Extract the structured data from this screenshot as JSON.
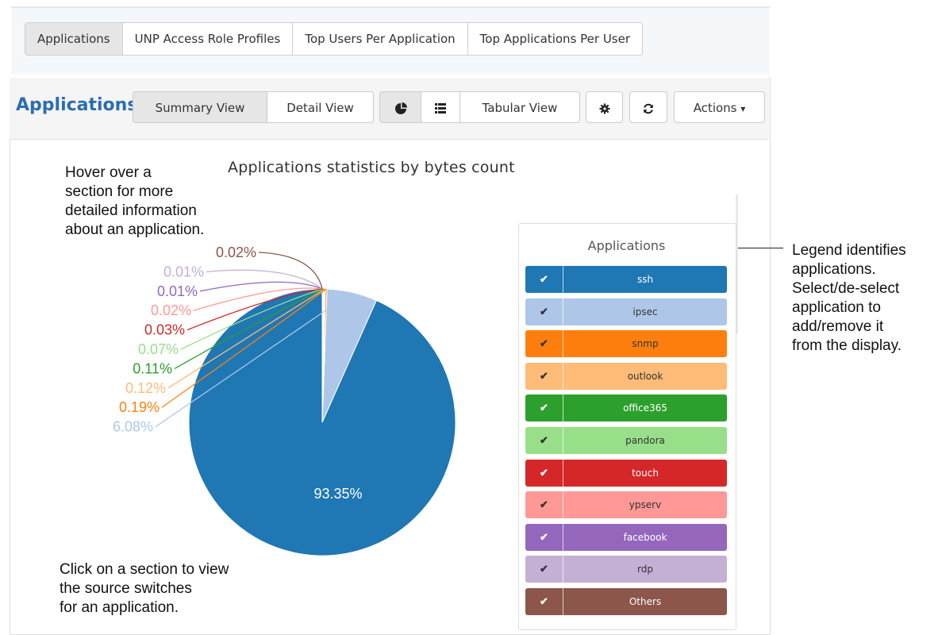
{
  "top_tabs": [
    {
      "label": "Applications",
      "active": true
    },
    {
      "label": "UNP Access Role Profiles",
      "active": false
    },
    {
      "label": "Top Users Per Application",
      "active": false
    },
    {
      "label": "Top Applications Per User",
      "active": false
    }
  ],
  "panel": {
    "title": "Applications",
    "summary_view_label": "Summary View",
    "detail_view_label": "Detail View",
    "pie_icon": "pie-chart-icon",
    "list_icon": "list-icon",
    "tabular_view_label": "Tabular View",
    "settings_icon": "gear-icon",
    "refresh_icon": "refresh-icon",
    "actions_label": "Actions",
    "actions_caret": "▾"
  },
  "annotations": {
    "hover_note": "Hover over a\nsection for more\ndetailed information\nabout an application.",
    "click_note": "Click on a section to view\nthe source switches\nfor an application.",
    "legend_note": "Legend identifies\napplications.\nSelect/de-select\napplication to\nadd/remove it\nfrom the display."
  },
  "legend": {
    "title": "Applications",
    "check_glyph": "✔"
  },
  "colors": {
    "accent": "#2a6db5"
  },
  "chart_data": {
    "type": "pie",
    "title": "Applications statistics by bytes count",
    "unit": "%",
    "slices": [
      {
        "name": "ssh",
        "value": 93.35,
        "label": "93.35%",
        "color": "#1f77b4",
        "text_color": "#ffffff",
        "selected": true
      },
      {
        "name": "ipsec",
        "value": 6.08,
        "label": "6.08%",
        "color": "#aec7e8",
        "text_color": "#333333",
        "selected": true
      },
      {
        "name": "snmp",
        "value": 0.19,
        "label": "0.19%",
        "color": "#ff7f0e",
        "text_color": "#333333",
        "selected": true
      },
      {
        "name": "outlook",
        "value": 0.12,
        "label": "0.12%",
        "color": "#ffbb78",
        "text_color": "#333333",
        "selected": true
      },
      {
        "name": "office365",
        "value": 0.11,
        "label": "0.11%",
        "color": "#2ca02c",
        "text_color": "#ffffff",
        "selected": true
      },
      {
        "name": "pandora",
        "value": 0.07,
        "label": "0.07%",
        "color": "#98df8a",
        "text_color": "#333333",
        "selected": true
      },
      {
        "name": "touch",
        "value": 0.03,
        "label": "0.03%",
        "color": "#d62728",
        "text_color": "#ffffff",
        "selected": true
      },
      {
        "name": "ypserv",
        "value": 0.02,
        "label": "0.02%",
        "color": "#ff9896",
        "text_color": "#333333",
        "selected": true
      },
      {
        "name": "facebook",
        "value": 0.01,
        "label": "0.01%",
        "color": "#9467bd",
        "text_color": "#ffffff",
        "selected": true
      },
      {
        "name": "rdp",
        "value": 0.01,
        "label": "0.01%",
        "color": "#c5b0d5",
        "text_color": "#333333",
        "selected": true
      },
      {
        "name": "Others",
        "value": 0.02,
        "label": "0.02%",
        "color": "#8c564b",
        "text_color": "#ffffff",
        "selected": true
      }
    ]
  }
}
